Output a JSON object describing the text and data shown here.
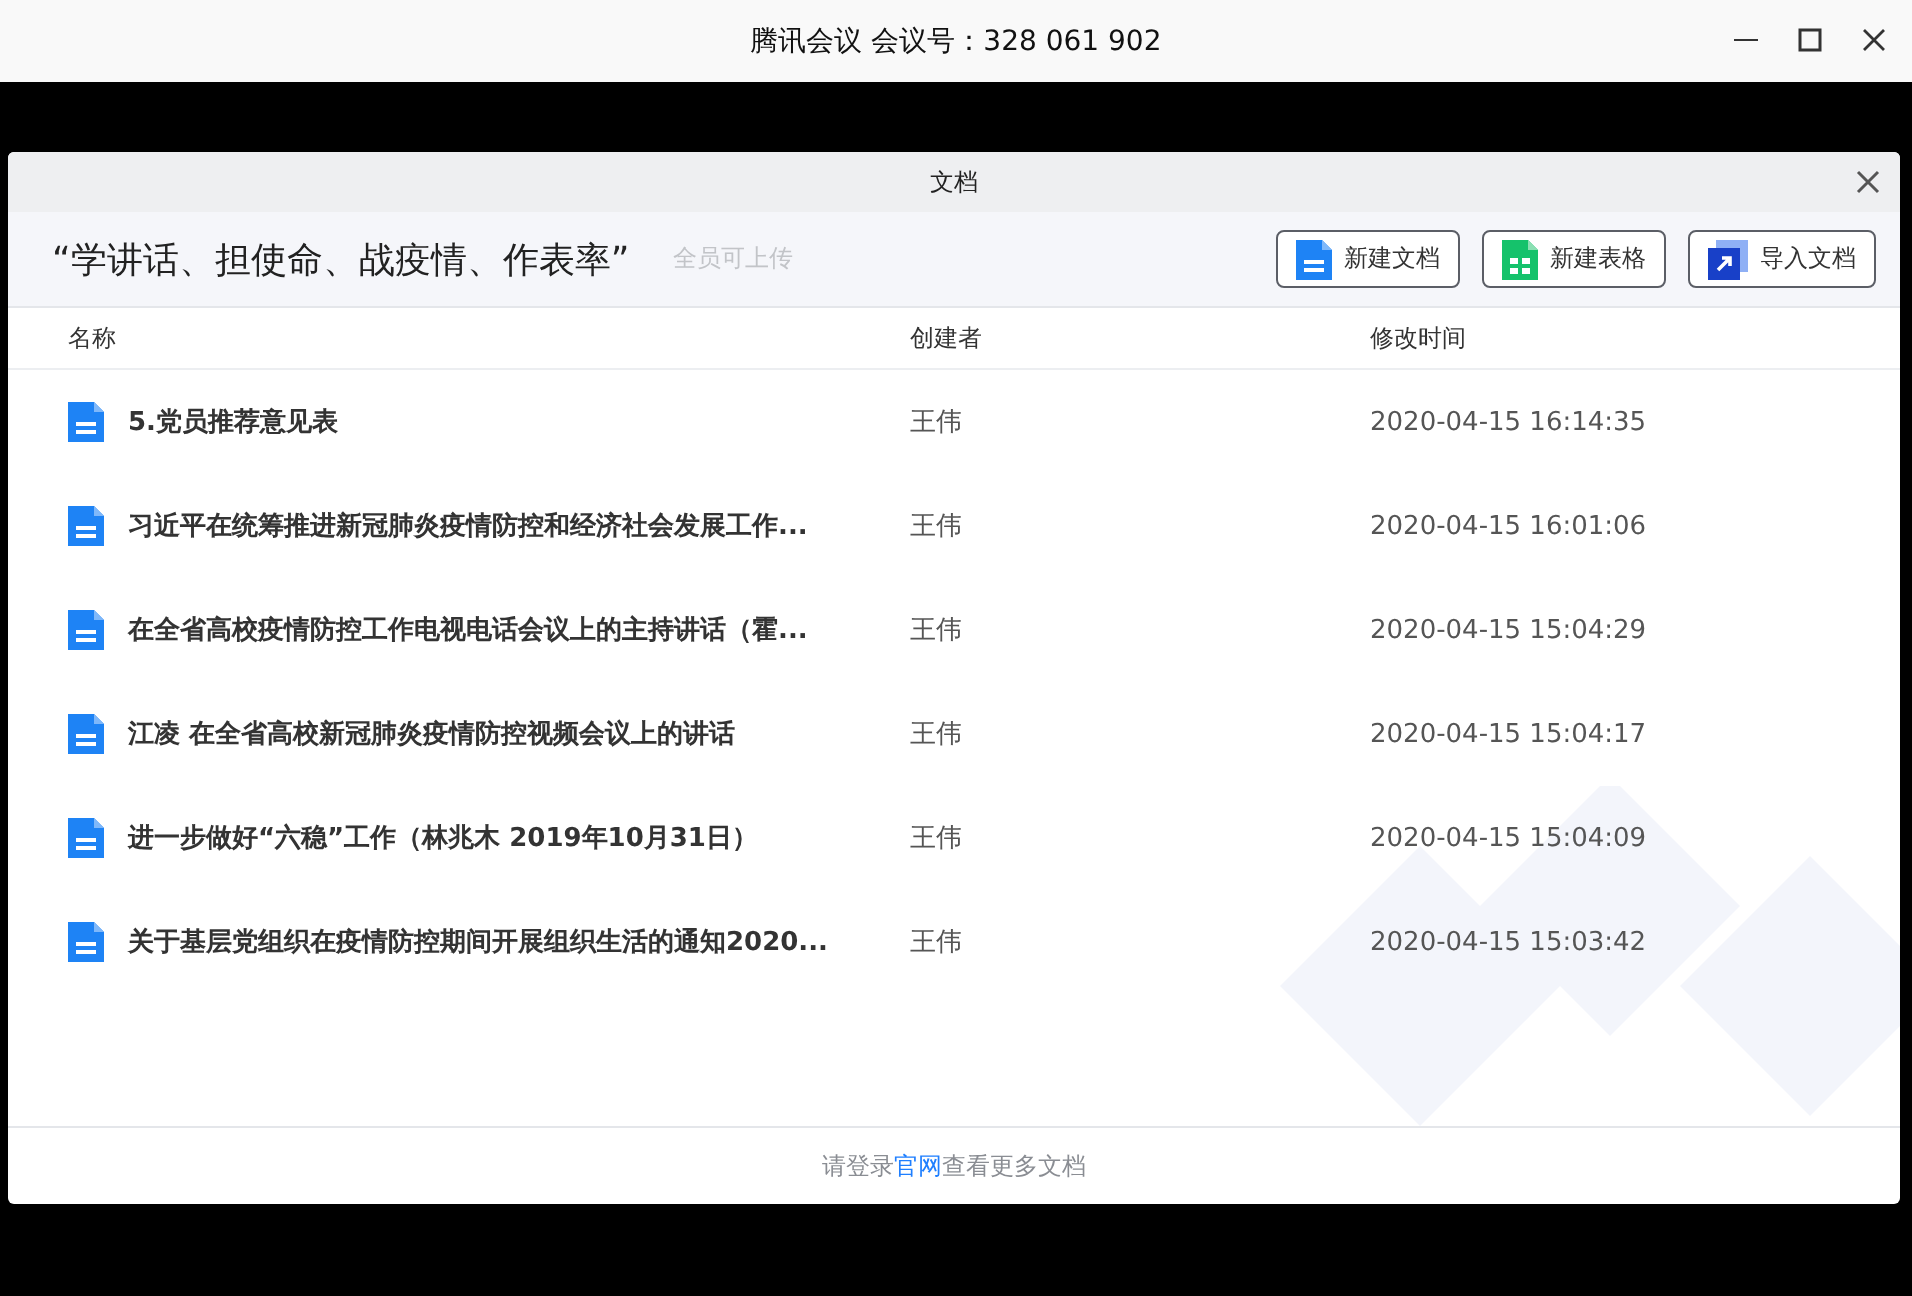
{
  "window": {
    "title": "腾讯会议 会议号：328 061 902"
  },
  "dialog": {
    "title": "文档",
    "heading": "“学讲话、担使命、战疫情、作表率”",
    "permission": "全员可上传",
    "buttons": [
      {
        "kind": "doc",
        "label": "新建文档"
      },
      {
        "kind": "sheet",
        "label": "新建表格"
      },
      {
        "kind": "import",
        "label": "导入文档"
      }
    ],
    "table": {
      "columns": [
        "名称",
        "创建者",
        "修改时间"
      ],
      "rows": [
        {
          "name": "5.党员推荐意见表",
          "creator": "王伟",
          "modified": "2020-04-15 16:14:35"
        },
        {
          "name": "习近平在统筹推进新冠肺炎疫情防控和经济社会发展工作...",
          "creator": "王伟",
          "modified": "2020-04-15 16:01:06"
        },
        {
          "name": "在全省高校疫情防控工作电视电话会议上的主持讲话（霍...",
          "creator": "王伟",
          "modified": "2020-04-15 15:04:29"
        },
        {
          "name": "江凌 在全省高校新冠肺炎疫情防控视频会议上的讲话",
          "creator": "王伟",
          "modified": "2020-04-15 15:04:17"
        },
        {
          "name": "进一步做好“六稳”工作（林兆木 2019年10月31日）",
          "creator": "王伟",
          "modified": "2020-04-15 15:04:09"
        },
        {
          "name": "关于基层党组织在疫情防控期间开展组织生活的通知2020...",
          "creator": "王伟",
          "modified": "2020-04-15 15:03:42"
        }
      ]
    },
    "footer": {
      "before": "请登录",
      "link": "官网",
      "after": "查看更多文档"
    }
  }
}
